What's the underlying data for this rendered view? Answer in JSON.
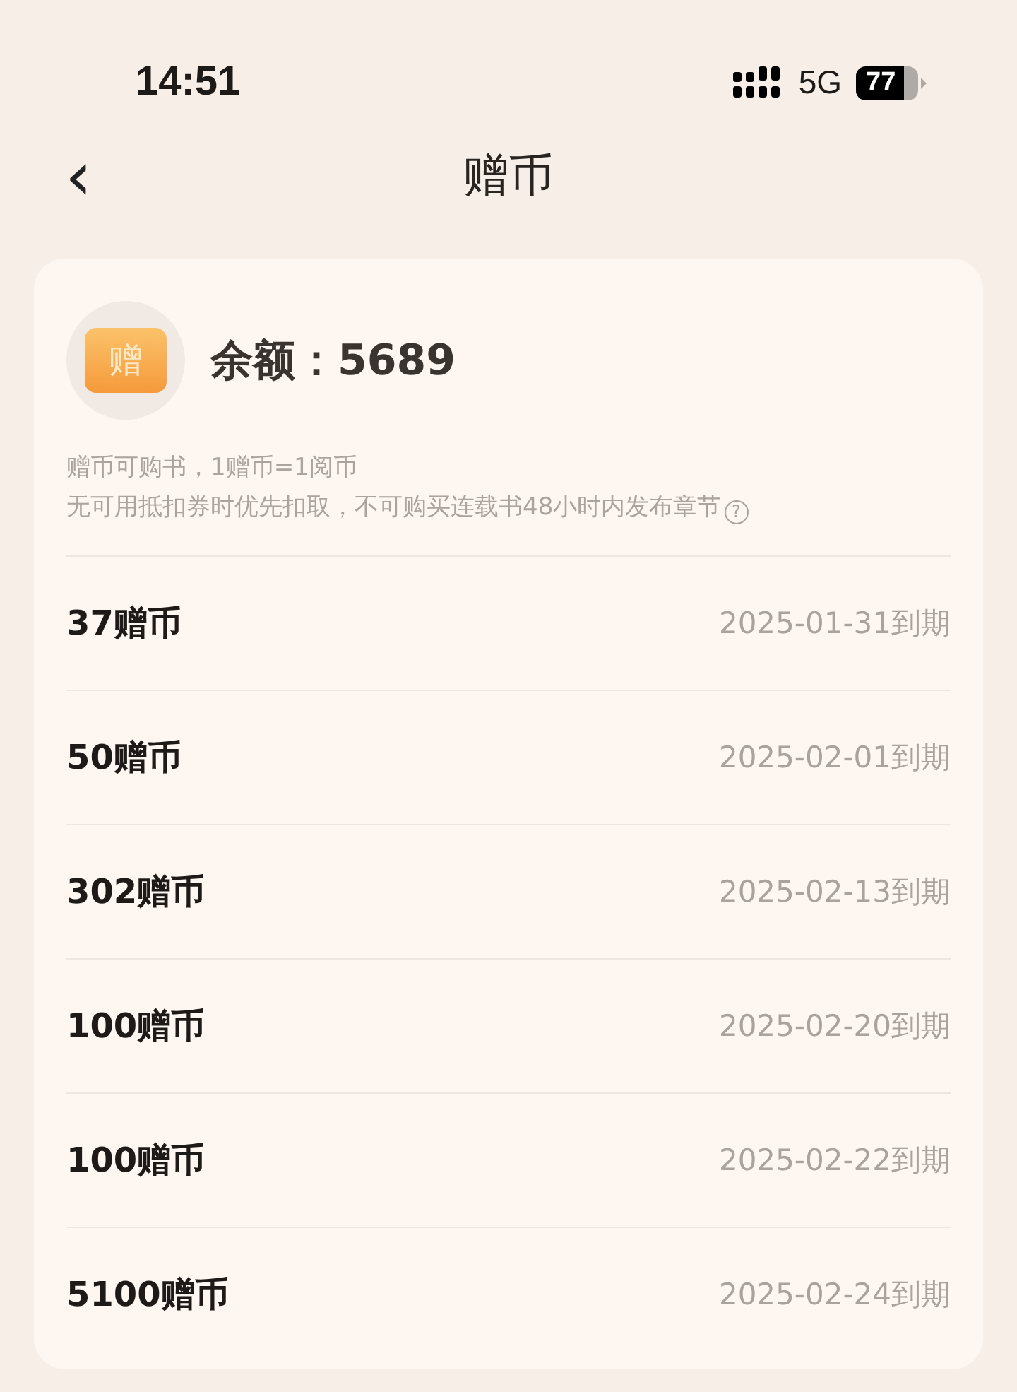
{
  "status_bar": {
    "time": "14:51",
    "network": "5G",
    "battery": "77"
  },
  "nav": {
    "back": "‹",
    "title": "赠币"
  },
  "summary": {
    "badge": "赠",
    "balance_label": "余额：",
    "balance": "5689",
    "notes": [
      "赠币可购书，1赠币=1阅币",
      "无可用抵扣券时优先扣取，不可购买连载书48小时内发布章节"
    ],
    "help": "?"
  },
  "items": [
    {
      "amount": "37赠币",
      "expiry": "2025-01-31到期"
    },
    {
      "amount": "50赠币",
      "expiry": "2025-02-01到期"
    },
    {
      "amount": "302赠币",
      "expiry": "2025-02-13到期"
    },
    {
      "amount": "100赠币",
      "expiry": "2025-02-20到期"
    },
    {
      "amount": "100赠币",
      "expiry": "2025-02-22到期"
    },
    {
      "amount": "5100赠币",
      "expiry": "2025-02-24到期"
    }
  ]
}
